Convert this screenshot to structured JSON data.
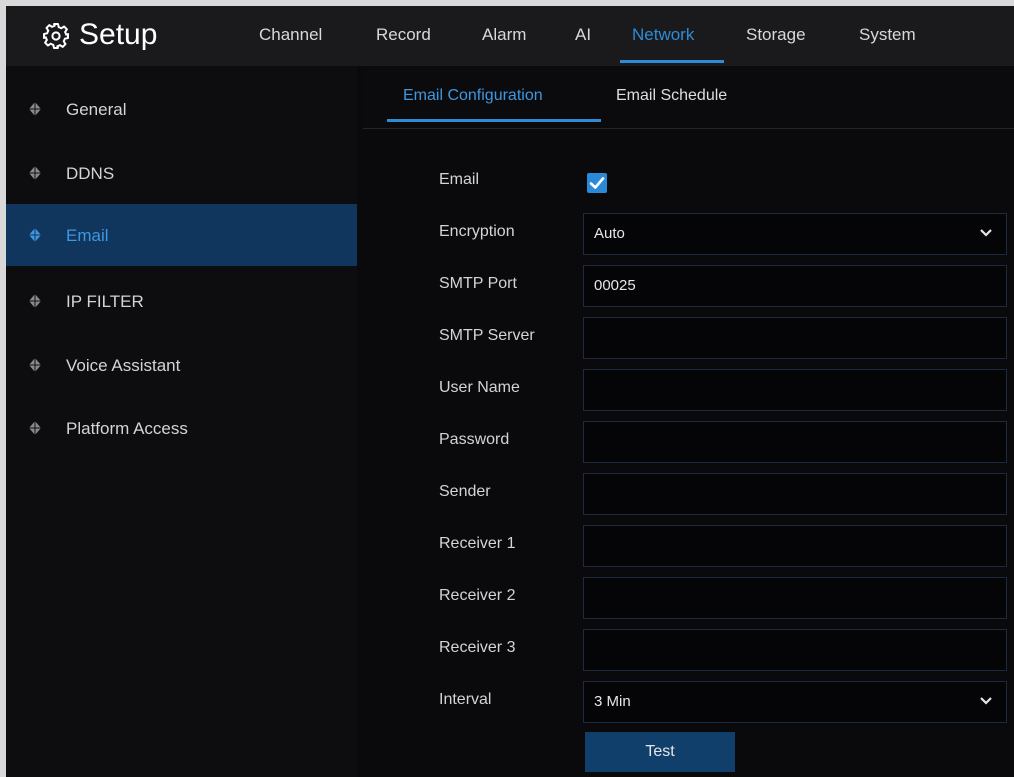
{
  "header": {
    "title": "Setup",
    "icon": "gear-icon",
    "tabs": [
      {
        "label": "Channel",
        "active": false
      },
      {
        "label": "Record",
        "active": false
      },
      {
        "label": "Alarm",
        "active": false
      },
      {
        "label": "AI",
        "active": false
      },
      {
        "label": "Network",
        "active": true
      },
      {
        "label": "Storage",
        "active": false
      },
      {
        "label": "System",
        "active": false
      }
    ]
  },
  "sidebar": {
    "items": [
      {
        "label": "General",
        "active": false
      },
      {
        "label": "DDNS",
        "active": false
      },
      {
        "label": "Email",
        "active": true
      },
      {
        "label": "IP FILTER",
        "active": false
      },
      {
        "label": "Voice Assistant",
        "active": false
      },
      {
        "label": "Platform Access",
        "active": false
      }
    ]
  },
  "main": {
    "subtabs": [
      {
        "label": "Email Configuration",
        "active": true
      },
      {
        "label": "Email Schedule",
        "active": false
      }
    ],
    "form": {
      "email": {
        "label": "Email",
        "checked": true
      },
      "encryption": {
        "label": "Encryption",
        "value": "Auto"
      },
      "smtp_port": {
        "label": "SMTP Port",
        "value": "00025"
      },
      "smtp_server": {
        "label": "SMTP Server",
        "value": ""
      },
      "user_name": {
        "label": "User Name",
        "value": ""
      },
      "password": {
        "label": "Password",
        "value": ""
      },
      "sender": {
        "label": "Sender",
        "value": ""
      },
      "receiver1": {
        "label": "Receiver 1",
        "value": ""
      },
      "receiver2": {
        "label": "Receiver 2",
        "value": ""
      },
      "receiver3": {
        "label": "Receiver 3",
        "value": ""
      },
      "interval": {
        "label": "Interval",
        "value": "3 Min"
      }
    },
    "test_label": "Test"
  },
  "colors": {
    "accent": "#2e8bd4",
    "active_row": "#11365d",
    "background": "#0a0a0d",
    "button": "#0f3f6a"
  }
}
